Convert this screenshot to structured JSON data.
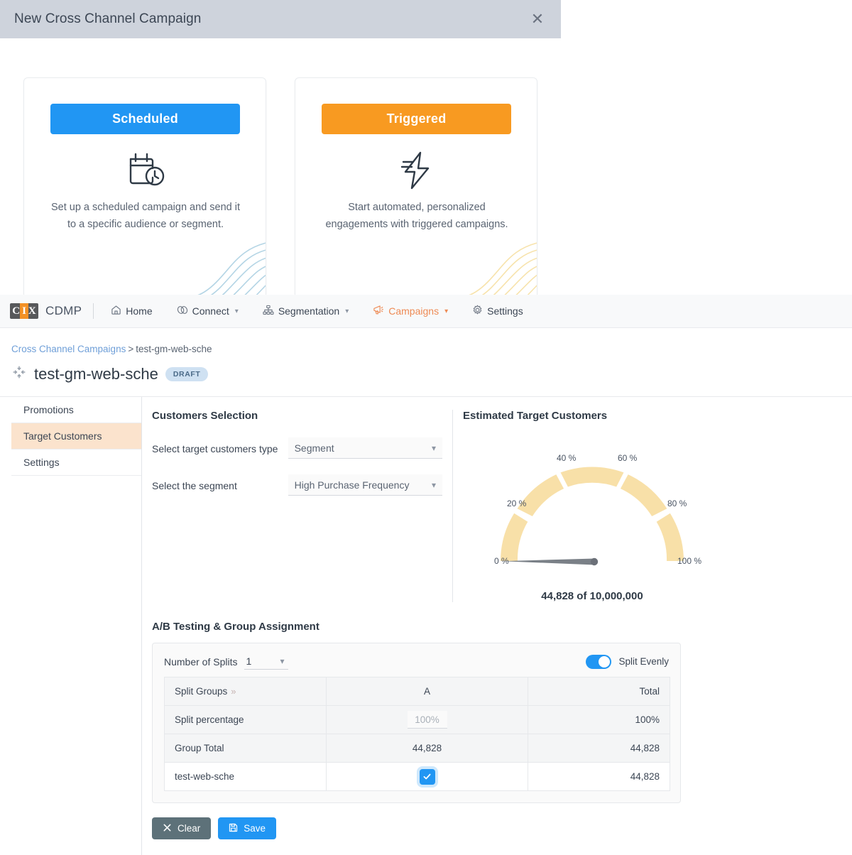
{
  "modal": {
    "title": "New Cross Channel Campaign",
    "close_icon": "close-icon",
    "cards": [
      {
        "button_label": "Scheduled",
        "accent": "#2196f3",
        "icon": "calendar-clock-icon",
        "description": "Set up a scheduled campaign and send it to a specific audience or segment."
      },
      {
        "button_label": "Triggered",
        "accent": "#f89a21",
        "icon": "lightning-bolt-icon",
        "description": "Start automated, personalized engagements with triggered campaigns."
      }
    ]
  },
  "topnav": {
    "logo": {
      "c": "C",
      "i": "I",
      "x": "X"
    },
    "product": "CDMP",
    "items": [
      {
        "label": "Home",
        "icon": "home-icon",
        "caret": false,
        "active": false
      },
      {
        "label": "Connect",
        "icon": "link-icon",
        "caret": true,
        "active": false
      },
      {
        "label": "Segmentation",
        "icon": "hierarchy-icon",
        "caret": true,
        "active": false
      },
      {
        "label": "Campaigns",
        "icon": "megaphone-icon",
        "caret": true,
        "active": true
      },
      {
        "label": "Settings",
        "icon": "gear-icon",
        "caret": false,
        "active": false
      }
    ],
    "active_color": "#ee8a54"
  },
  "breadcrumb": {
    "root": "Cross Channel Campaigns",
    "separator": ">",
    "current": "test-gm-web-sche"
  },
  "page": {
    "icon": "collapse-arrows-icon",
    "title": "test-gm-web-sche",
    "badge": "DRAFT",
    "badge_color": "#cfe1f2"
  },
  "sidebar": {
    "items": [
      {
        "label": "Promotions",
        "active": false
      },
      {
        "label": "Target Customers",
        "active": true
      },
      {
        "label": "Settings",
        "active": false
      }
    ],
    "active_bg": "#fbe3cd"
  },
  "customers_selection": {
    "title": "Customers Selection",
    "fields": [
      {
        "label": "Select target customers type",
        "value": "Segment"
      },
      {
        "label": "Select the segment",
        "value": "High Purchase Frequency"
      }
    ]
  },
  "chart_data": {
    "type": "gauge",
    "title": "Estimated Target Customers",
    "caption": "44,828 of 10,000,000",
    "value": 44828,
    "max": 10000000,
    "percent": 0.448,
    "unit": "%",
    "arc_color": "#f8e0a8",
    "needle_color": "#6b7078",
    "tick_labels": [
      "0 %",
      "20 %",
      "40 %",
      "60 %",
      "80 %",
      "100 %"
    ],
    "tick_values": [
      0,
      20,
      40,
      60,
      80,
      100
    ],
    "segments": [
      {
        "from": 0,
        "to": 20
      },
      {
        "from": 20,
        "to": 40
      },
      {
        "from": 40,
        "to": 60
      },
      {
        "from": 60,
        "to": 80
      },
      {
        "from": 80,
        "to": 100
      }
    ],
    "axis_range": [
      0,
      100
    ]
  },
  "ab_testing": {
    "title": "A/B Testing & Group Assignment",
    "splits_label": "Number of Splits",
    "splits_value": "1",
    "toggle_label": "Split Evenly",
    "toggle_on": true,
    "table": {
      "header": {
        "label": "Split Groups",
        "chevrons": "»",
        "a": "A",
        "total": "Total"
      },
      "rows": [
        {
          "label": "Split percentage",
          "a": "100%",
          "a_type": "input",
          "total": "100%",
          "total_style": "green"
        },
        {
          "label": "Group Total",
          "a": "44,828",
          "a_type": "text",
          "total": "44,828",
          "total_style": "plain"
        },
        {
          "label": "test-web-sche",
          "a": "",
          "a_type": "checkbox",
          "total": "44,828",
          "total_style": "plain"
        }
      ]
    }
  },
  "buttons": {
    "clear": {
      "label": "Clear",
      "icon": "x-icon",
      "color": "#5d7179"
    },
    "save": {
      "label": "Save",
      "icon": "save-disk-icon",
      "color": "#2196f3"
    }
  }
}
